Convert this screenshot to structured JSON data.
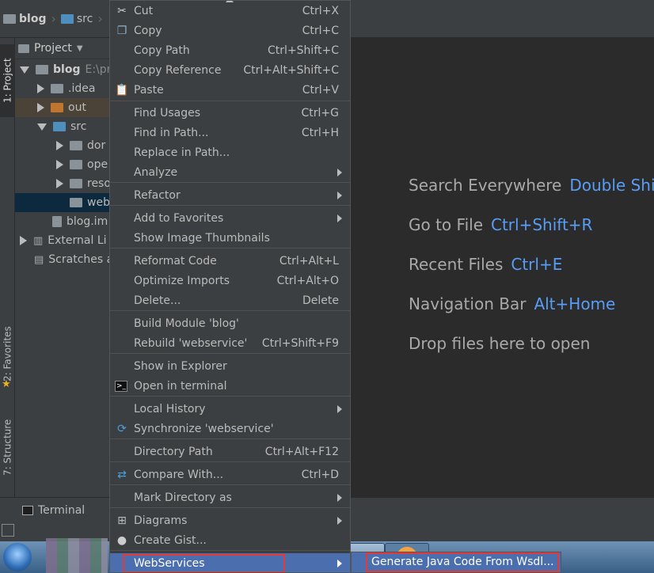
{
  "breadcrumbs": [
    "blog",
    "src"
  ],
  "left_tabs": {
    "project": "1: Project",
    "favorites": "2: Favorites",
    "structure": "7: Structure"
  },
  "project_panel": {
    "title": "Project",
    "tree": [
      {
        "label": "blog",
        "extra": "E:\\pr",
        "state": "expanded"
      },
      {
        "label": ".idea",
        "state": "collapsed"
      },
      {
        "label": "out",
        "state": "collapsed"
      },
      {
        "label": "src",
        "state": "expanded"
      },
      {
        "label": "dor",
        "state": "collapsed"
      },
      {
        "label": "ope",
        "state": "collapsed"
      },
      {
        "label": "reso",
        "state": "collapsed"
      },
      {
        "label": "web",
        "state": "selected"
      },
      {
        "label": "blog.im",
        "state": "leaf"
      },
      {
        "label": "External Li",
        "state": "collapsed"
      },
      {
        "label": "Scratches a",
        "state": "leaf"
      }
    ]
  },
  "editor_hints": [
    {
      "text": "Search Everywhere",
      "key": "Double Shift"
    },
    {
      "text": "Go to File",
      "key": "Ctrl+Shift+R"
    },
    {
      "text": "Recent Files",
      "key": "Ctrl+E"
    },
    {
      "text": "Navigation Bar",
      "key": "Alt+Home"
    },
    {
      "text": "Drop files here to open",
      "key": ""
    }
  ],
  "context_menu": [
    {
      "label": "Cut",
      "shortcut": "Ctrl+X",
      "icon": "scissors-icon"
    },
    {
      "label": "Copy",
      "shortcut": "Ctrl+C",
      "icon": "copy-icon"
    },
    {
      "label": "Copy Path",
      "shortcut": "Ctrl+Shift+C"
    },
    {
      "label": "Copy Reference",
      "shortcut": "Ctrl+Alt+Shift+C"
    },
    {
      "label": "Paste",
      "shortcut": "Ctrl+V",
      "icon": "paste-icon"
    },
    {
      "label": "Find Usages",
      "shortcut": "Ctrl+G"
    },
    {
      "label": "Find in Path...",
      "shortcut": "Ctrl+H"
    },
    {
      "label": "Replace in Path..."
    },
    {
      "label": "Analyze",
      "submenu": true
    },
    {
      "label": "Refactor",
      "submenu": true
    },
    {
      "label": "Add to Favorites",
      "submenu": true
    },
    {
      "label": "Show Image Thumbnails"
    },
    {
      "label": "Reformat Code",
      "shortcut": "Ctrl+Alt+L"
    },
    {
      "label": "Optimize Imports",
      "shortcut": "Ctrl+Alt+O"
    },
    {
      "label": "Delete...",
      "shortcut": "Delete"
    },
    {
      "label": "Build Module 'blog'"
    },
    {
      "label": "Rebuild 'webservice'",
      "shortcut": "Ctrl+Shift+F9"
    },
    {
      "label": "Show in Explorer"
    },
    {
      "label": "Open in terminal",
      "icon": "terminal-icon"
    },
    {
      "label": "Local History",
      "submenu": true
    },
    {
      "label": "Synchronize 'webservice'",
      "icon": "sync-icon"
    },
    {
      "label": "Directory Path",
      "shortcut": "Ctrl+Alt+F12"
    },
    {
      "label": "Compare With...",
      "shortcut": "Ctrl+D",
      "icon": "compare-icon"
    },
    {
      "label": "Mark Directory as",
      "submenu": true
    },
    {
      "label": "Diagrams",
      "submenu": true,
      "icon": "diagram-icon"
    },
    {
      "label": "Create Gist...",
      "icon": "github-icon"
    },
    {
      "label": "WebServices",
      "submenu": true,
      "highlighted": true
    }
  ],
  "submenu": {
    "item": "Generate Java Code From Wsdl..."
  },
  "bottom_bar": {
    "terminal": "Terminal"
  },
  "colors": {
    "accent": "#4b6eaf",
    "key_blue": "#589df6",
    "annotation_red": "#e23a3a"
  }
}
